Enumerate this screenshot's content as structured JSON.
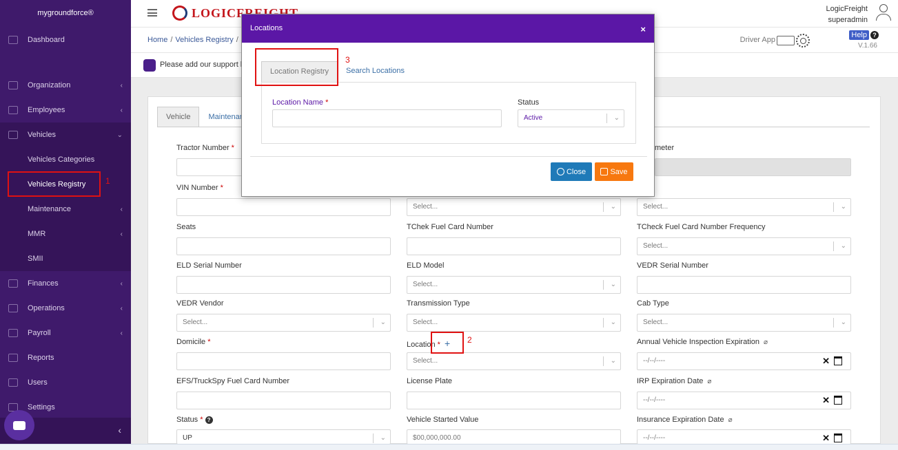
{
  "sidebar": {
    "brand": "mygroundforce®",
    "items": [
      {
        "label": "Dashboard",
        "has_sub": false
      },
      {
        "label": "Organization",
        "has_sub": true
      },
      {
        "label": "Employees",
        "has_sub": true
      },
      {
        "label": "Vehicles",
        "has_sub": true,
        "expanded": true
      },
      {
        "label": "Finances",
        "has_sub": true
      },
      {
        "label": "Operations",
        "has_sub": true
      },
      {
        "label": "Payroll",
        "has_sub": true
      },
      {
        "label": "Reports",
        "has_sub": false
      },
      {
        "label": "Users",
        "has_sub": false
      },
      {
        "label": "Settings",
        "has_sub": false
      }
    ],
    "vehicles_sub": [
      {
        "label": "Vehicles Categories"
      },
      {
        "label": "Vehicles Registry",
        "active": true
      },
      {
        "label": "Maintenance",
        "has_sub": true
      },
      {
        "label": "MMR",
        "has_sub": true
      },
      {
        "label": "SMII",
        "has_sub": false
      }
    ],
    "collapse_arrow": "‹"
  },
  "header": {
    "logo_text": "LOGICFREIGHT",
    "user_name": "LogicFreight",
    "user_role": "superadmin"
  },
  "subbar": {
    "breadcrumb": [
      "Home",
      "Vehicles Registry",
      ""
    ],
    "driver_app": "Driver App",
    "help": "Help",
    "version": "V.1.66"
  },
  "notice": {
    "text": "Please add our support he"
  },
  "form_tabs": [
    "Vehicle",
    "Maintenan"
  ],
  "form": {
    "tractor_number": "Tractor Number",
    "odometer_partial": "meter",
    "vin_number": "VIN Number",
    "select": "Select...",
    "seats": "Seats",
    "tchek_fuel_card": "TChek Fuel Card Number",
    "tcheck_fuel_freq": "TCheck Fuel Card Number Frequency",
    "eld_serial": "ELD Serial Number",
    "eld_model": "ELD Model",
    "vedr_serial": "VEDR Serial Number",
    "vedr_vendor": "VEDR Vendor",
    "transmission_type": "Transmission Type",
    "cab_type": "Cab Type",
    "domicile": "Domicile",
    "location": "Location",
    "annual_inspection": "Annual Vehicle Inspection Expiration",
    "efs_fuel_card": "EFS/TruckSpy Fuel Card Number",
    "license_plate": "License Plate",
    "irp_expiration": "IRP Expiration Date",
    "status": "Status",
    "status_value": "UP",
    "vehicle_started_value": "Vehicle Started Value",
    "vehicle_started_placeholder": "$00,000,000.00",
    "insurance_expiration": "Insurance Expiration Date",
    "date_placeholder": "--/--/----",
    "required_mark": "*",
    "plus": "+"
  },
  "annotations": {
    "one": "1",
    "two": "2",
    "three": "3"
  },
  "modal": {
    "title": "Locations",
    "close_x": "×",
    "tabs": [
      "Location Registry",
      "Search Locations"
    ],
    "location_name_label": "Location Name",
    "status_label": "Status",
    "status_value": "Active",
    "close_button": "Close",
    "save_button": "Save"
  },
  "colors": {
    "sidebar": "#3f1a6b",
    "modal_header": "#5b17a6",
    "close_button": "#1f7ab8",
    "save_button": "#f7780f",
    "annotation": "#e01111"
  }
}
